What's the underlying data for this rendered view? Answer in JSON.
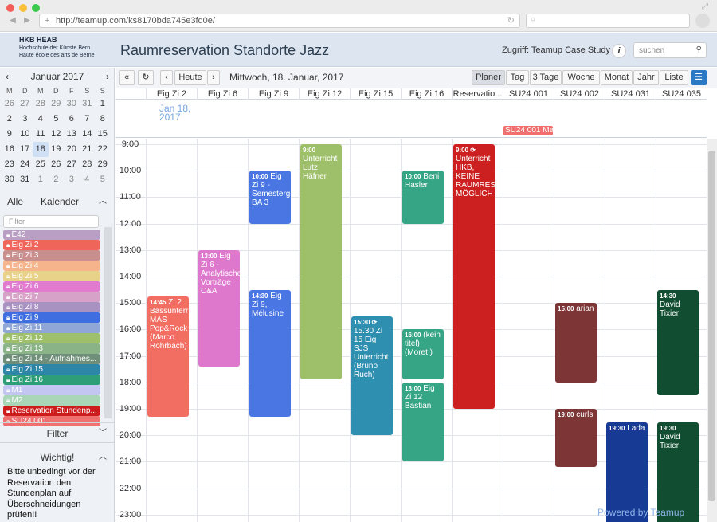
{
  "browser": {
    "url": "http://teamup.com/ks8170bda745e3fd0e/"
  },
  "header": {
    "logo_line1": "HKB HEAB",
    "logo_line2": "Hochschule der Künste Bern",
    "logo_line3": "Haute école des arts de Berne",
    "title": "Raumreservation Standorte Jazz",
    "access": "Zugriff: Teamup Case Study",
    "search_placeholder": "suchen"
  },
  "minical": {
    "month": "Januar 2017",
    "dow": [
      "M",
      "D",
      "M",
      "D",
      "F",
      "S",
      "S"
    ],
    "weeks": [
      [
        "26",
        "27",
        "28",
        "29",
        "30",
        "31",
        "1"
      ],
      [
        "2",
        "3",
        "4",
        "5",
        "6",
        "7",
        "8"
      ],
      [
        "9",
        "10",
        "11",
        "12",
        "13",
        "14",
        "15"
      ],
      [
        "16",
        "17",
        "18",
        "19",
        "20",
        "21",
        "22"
      ],
      [
        "23",
        "24",
        "25",
        "26",
        "27",
        "28",
        "29"
      ],
      [
        "30",
        "31",
        "1",
        "2",
        "3",
        "4",
        "5"
      ]
    ]
  },
  "sidebar": {
    "all": "Alle",
    "calendars": "Kalender",
    "filter_placeholder": "Filter",
    "subcalendars": [
      {
        "name": "E42",
        "color": "#b99fc4"
      },
      {
        "name": "Eig Zi 2",
        "color": "#f0655a"
      },
      {
        "name": "Eig Zi 3",
        "color": "#c98e8e"
      },
      {
        "name": "Eig Zi 4",
        "color": "#f5b48c"
      },
      {
        "name": "Eig Zi 5",
        "color": "#e8d28a"
      },
      {
        "name": "Eig Zi 6",
        "color": "#e07bd0"
      },
      {
        "name": "Eig Zi 7",
        "color": "#d6a2c8"
      },
      {
        "name": "Eig Zi 8",
        "color": "#a792c2"
      },
      {
        "name": "Eig Zi 9",
        "color": "#3e6ee0"
      },
      {
        "name": "Eig Zi 11",
        "color": "#8fa6d6"
      },
      {
        "name": "Eig Zi 12",
        "color": "#9fc06a"
      },
      {
        "name": "Eig Zi 13",
        "color": "#8ab388"
      },
      {
        "name": "Eig Zi 14 - Aufnahmes...",
        "color": "#6f8f7a"
      },
      {
        "name": "Eig Zi 15",
        "color": "#2d86a8"
      },
      {
        "name": "Eig Zi 16",
        "color": "#2e9e78"
      },
      {
        "name": "M1",
        "color": "#c2c6f0"
      },
      {
        "name": "M2",
        "color": "#a9d6b7"
      },
      {
        "name": "Reservation Stundenp...",
        "color": "#cc1c1c"
      },
      {
        "name": "SU24 001",
        "color": "#f07070"
      }
    ],
    "filter_label": "Filter",
    "important_title": "Wichtig!",
    "important_text": "Bitte unbedingt vor der Reservation den Stundenplan auf Überschneidungen prüfen!!"
  },
  "toolbar": {
    "today": "Heute",
    "date": "Mittwoch, 18. Januar, 2017",
    "views": [
      "Planer",
      "Tag",
      "3 Tage",
      "Woche",
      "Monat",
      "Jahr",
      "Liste"
    ],
    "active_view": "Planer"
  },
  "columns": [
    "Eig Zi 2",
    "Eig Zi 6",
    "Eig Zi 9",
    "Eig Zi 12",
    "Eig Zi 15",
    "Eig Zi 16",
    "Reservatio...",
    "SU24 001",
    "SU24 002",
    "SU24 031",
    "SU24 035"
  ],
  "allday": {
    "date_label": "Jan 18, 2017",
    "su24_event": "SU24 001 Ma"
  },
  "hours": [
    "9:00",
    "10:00",
    "11:00",
    "12:00",
    "13:00",
    "14:00",
    "15:00",
    "16:00",
    "17:00",
    "18:00",
    "19:00",
    "20:00",
    "21:00",
    "22:00",
    "23:00"
  ],
  "events": [
    {
      "col": 0,
      "start": 14.75,
      "end": 19.3,
      "time": "14:45",
      "text": "Zi 2 Bassunterr MAS Pop&Rock (Marco Rohrbach)",
      "color": "#f26e63"
    },
    {
      "col": 1,
      "start": 13.0,
      "end": 17.4,
      "time": "13:00",
      "text": "Eig Zi 6 - Analytische Vorträge C&A",
      "color": "#dd78cc"
    },
    {
      "col": 2,
      "start": 10.0,
      "end": 12.0,
      "time": "10:00",
      "text": "Eig Zi 9 - Semesterg BA 3",
      "color": "#4a76e4"
    },
    {
      "col": 2,
      "start": 14.5,
      "end": 19.3,
      "time": "14:30",
      "text": "Eig Zi 9, Mélusine",
      "color": "#4a76e4"
    },
    {
      "col": 3,
      "start": 9.0,
      "end": 17.9,
      "time": "9:00",
      "text": "Unterricht Lutz Häfner",
      "color": "#9fc06a"
    },
    {
      "col": 4,
      "start": 15.5,
      "end": 20.0,
      "time": "15:30 ⟳",
      "text": "15.30 Zi 15 Eig SJS Unterricht (Bruno Ruch)",
      "color": "#2e8fb0"
    },
    {
      "col": 5,
      "start": 10.0,
      "end": 12.0,
      "time": "10:00",
      "text": "Beni Hasler",
      "color": "#36a585"
    },
    {
      "col": 5,
      "start": 16.0,
      "end": 17.9,
      "time": "16:00",
      "text": "(kein titel) (Moret )",
      "color": "#36a585"
    },
    {
      "col": 5,
      "start": 18.0,
      "end": 21.0,
      "time": "18:00",
      "text": "Eig Zi 12 Bastian",
      "color": "#36a585"
    },
    {
      "col": 6,
      "start": 9.0,
      "end": 19.0,
      "time": "9:00 ⟳",
      "text": "Unterricht HKB, KEINE RAUMRES MÖGLICH",
      "color": "#cc2020"
    },
    {
      "col": 8,
      "start": 15.0,
      "end": 18.0,
      "time": "15:00",
      "text": "arian",
      "color": "#7d3535"
    },
    {
      "col": 8,
      "start": 19.0,
      "end": 21.2,
      "time": "19:00",
      "text": "curls",
      "color": "#7d3535"
    },
    {
      "col": 9,
      "start": 19.5,
      "end": 24.0,
      "time": "19:30",
      "text": "Lada",
      "color": "#173a94"
    },
    {
      "col": 10,
      "start": 14.5,
      "end": 18.5,
      "time": "14:30",
      "text": "David Tixier",
      "color": "#114d30"
    },
    {
      "col": 10,
      "start": 19.5,
      "end": 24.0,
      "time": "19:30",
      "text": "David Tixier",
      "color": "#114d30"
    }
  ],
  "footer": {
    "powered": "Powered by Teamup"
  }
}
